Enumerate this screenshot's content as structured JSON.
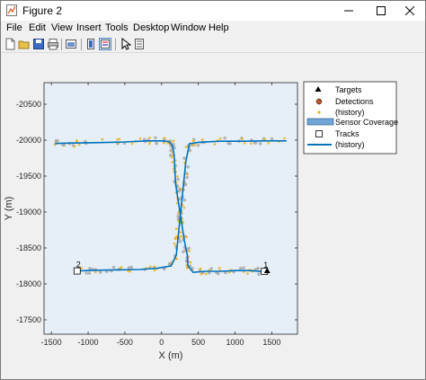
{
  "window": {
    "title": "Figure 2",
    "controls": {
      "minimize": "—",
      "maximize": "☐",
      "close": "✕"
    }
  },
  "menu": [
    "File",
    "Edit",
    "View",
    "Insert",
    "Tools",
    "Desktop",
    "Window",
    "Help"
  ],
  "toolbar": {
    "icons": [
      "new-figure-icon",
      "open-file-icon",
      "save-icon",
      "print-icon",
      "link-plot-icon",
      "insert-colorbar-icon",
      "insert-legend-icon",
      "edit-plot-icon",
      "property-inspector-icon"
    ]
  },
  "colors": {
    "plot_background": "#e6eff8",
    "track_line": "#0072bd",
    "detection_history": "#a9a9a9",
    "target_history": "#edb120",
    "sensor_coverage": "#6fa6d6"
  },
  "chart_data": {
    "type": "line",
    "xlabel": "X (m)",
    "ylabel": "Y (m)",
    "xlim": [
      -1600,
      1850
    ],
    "ylim": [
      -17300,
      -20800
    ],
    "y_reversed": true,
    "xticks": [
      -1500,
      -1000,
      -500,
      0,
      500,
      1000,
      1500
    ],
    "yticks": [
      -20500,
      -20000,
      -19500,
      -19000,
      -18500,
      -18000,
      -17500
    ],
    "legend": {
      "placement": "outside-right",
      "entries": [
        "Targets",
        "Detections",
        "(history)",
        "Sensor Coverage",
        "Tracks",
        "(history)"
      ]
    },
    "series": [
      {
        "name": "Tracks (history) 1",
        "x": [
          1400,
          1200,
          1000,
          800,
          600,
          430,
          360,
          350,
          310,
          280,
          250,
          220,
          190,
          180,
          170,
          150,
          100,
          0,
          -200,
          -500,
          -900,
          -1200,
          -1400,
          -1450
        ],
        "y": [
          -18170,
          -18185,
          -18185,
          -18175,
          -18175,
          -18160,
          -18250,
          -18400,
          -18600,
          -18800,
          -19000,
          -19200,
          -19400,
          -19600,
          -19800,
          -19920,
          -19980,
          -19990,
          -19990,
          -19975,
          -19965,
          -19960,
          -19955,
          -19950
        ]
      },
      {
        "name": "Tracks (history) 2",
        "x": [
          -1150,
          -900,
          -600,
          -300,
          -50,
          130,
          200,
          220,
          240,
          260,
          280,
          300,
          330,
          380,
          500,
          800,
          1100,
          1400,
          1700
        ],
        "y": [
          -18180,
          -18190,
          -18195,
          -18200,
          -18220,
          -18250,
          -18400,
          -18600,
          -18800,
          -19000,
          -19200,
          -19400,
          -19700,
          -19950,
          -19970,
          -19985,
          -19985,
          -19990,
          -19990
        ]
      },
      {
        "name": "Targets",
        "x": [
          1400,
          -1150
        ],
        "y": [
          -18175,
          -18180
        ],
        "labels": [
          "1",
          "2"
        ]
      }
    ]
  }
}
